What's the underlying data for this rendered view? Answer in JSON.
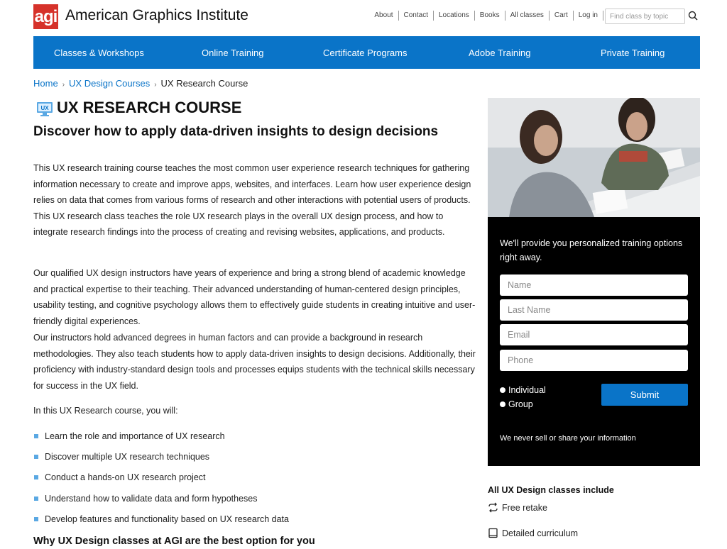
{
  "header": {
    "logo_text": "agi",
    "site_title": "American Graphics Institute",
    "top_links": [
      "About",
      "Contact",
      "Locations",
      "Books",
      "All classes",
      "Cart",
      "Log in"
    ],
    "search_placeholder": "Find class by topic"
  },
  "nav": {
    "items": [
      "Classes & Workshops",
      "Online Training",
      "Certificate Programs",
      "Adobe Training",
      "Private Training"
    ]
  },
  "breadcrumb": {
    "home": "Home",
    "parent": "UX Design Courses",
    "current": "UX Research Course",
    "separator": "›"
  },
  "main": {
    "icon_text": "UX",
    "title": "UX RESEARCH COURSE",
    "subtitle": "Discover how to apply data-driven insights to design decisions",
    "para1": "This UX research training course teaches the most common user experience research techniques for gathering information necessary to create and improve apps, websites, and interfaces. Learn how user experience design relies on data that comes from various forms of research and other interactions with potential users of products. This UX research class teaches the role UX research plays in the overall UX design process, and how to integrate research findings into the process of creating and revising websites, applications, and products.",
    "para2": "Our qualified UX design instructors have years of experience and bring a strong blend of academic knowledge and practical expertise to their teaching. Their advanced understanding of human-centered design principles, usability testing, and cognitive psychology allows them to effectively guide students in creating intuitive and user-friendly digital experiences.",
    "para3": "Our instructors hold advanced degrees in human factors and can provide a background in research methodologies. They also teach students how to apply data-driven insights to design decisions. Additionally, their proficiency with industry-standard design tools and processes equips students with the technical skills necessary for success in the UX field.",
    "list_intro": "In this UX Research course, you will:",
    "bullets": [
      "Learn the role and importance of UX research",
      "Discover multiple UX research techniques",
      "Conduct a hands-on UX research project",
      "Understand how to validate data and form hypotheses",
      "Develop features and functionality based on UX research data"
    ],
    "why_heading": "Why UX Design classes at AGI are the best option for you"
  },
  "form": {
    "intro": "We'll provide you personalized training options right away.",
    "name_placeholder": "Name",
    "last_name_placeholder": "Last Name",
    "email_placeholder": "Email",
    "phone_placeholder": "Phone",
    "radio_individual": "Individual",
    "radio_group": "Group",
    "submit_label": "Submit",
    "privacy": "We never sell or share your information"
  },
  "includes": {
    "title": "All UX Design classes include",
    "items": [
      "Free retake",
      "Detailed curriculum"
    ]
  },
  "colors": {
    "brand_blue": "#0a74c8",
    "logo_red": "#d6322a",
    "bullet_blue": "#5aa8e3"
  }
}
